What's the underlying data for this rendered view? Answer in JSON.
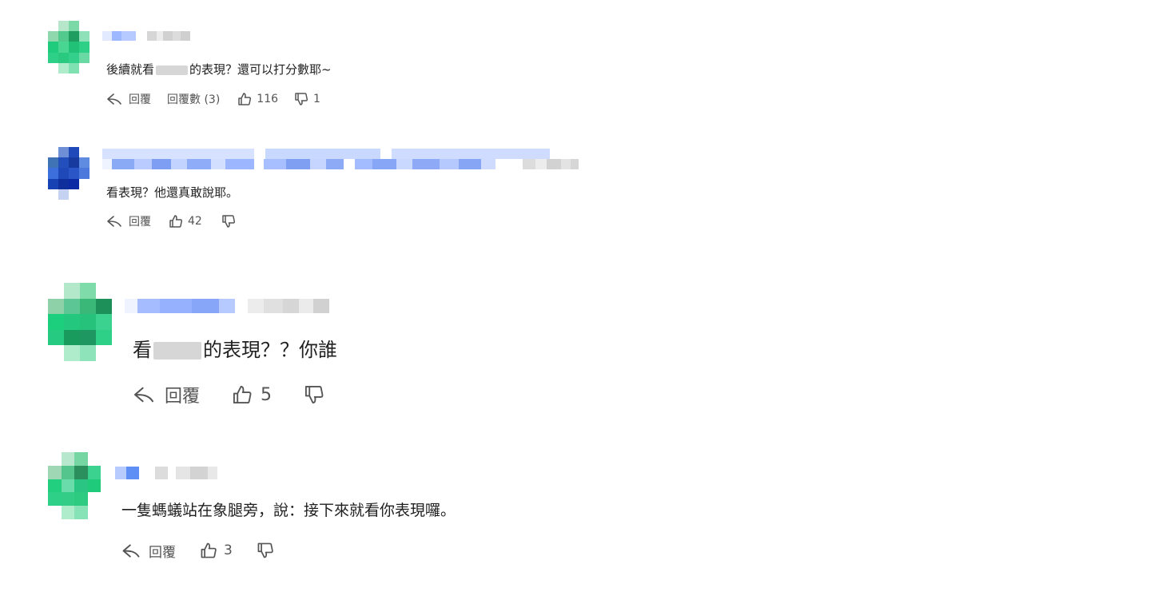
{
  "comments": [
    {
      "text_before": "後續就看",
      "text_after": "的表現？還可以打分數耶~",
      "reply_label": "回覆",
      "replies_label": "回覆數 (3)",
      "likes": "116",
      "dislikes": "1"
    },
    {
      "text": "看表現？他還真敢說耶。",
      "reply_label": "回覆",
      "likes": "42",
      "dislikes": ""
    },
    {
      "text_before": "看",
      "text_after": "的表現？？你誰",
      "reply_label": "回覆",
      "likes": "5",
      "dislikes": ""
    },
    {
      "text": "一隻螞蟻站在象腿旁，說：接下來就看你表現囉。",
      "reply_label": "回覆",
      "likes": "3",
      "dislikes": ""
    }
  ],
  "icons": {
    "reply": "reply-arrow-icon",
    "like": "thumbs-up-icon",
    "dislike": "thumbs-down-icon"
  },
  "colors": {
    "avatar_green": "#2ecf86",
    "avatar_blue": "#1f48b8",
    "name_blue": "#8fb0ff",
    "name_gray": "#d3d3d3",
    "action_gray": "#555555"
  }
}
